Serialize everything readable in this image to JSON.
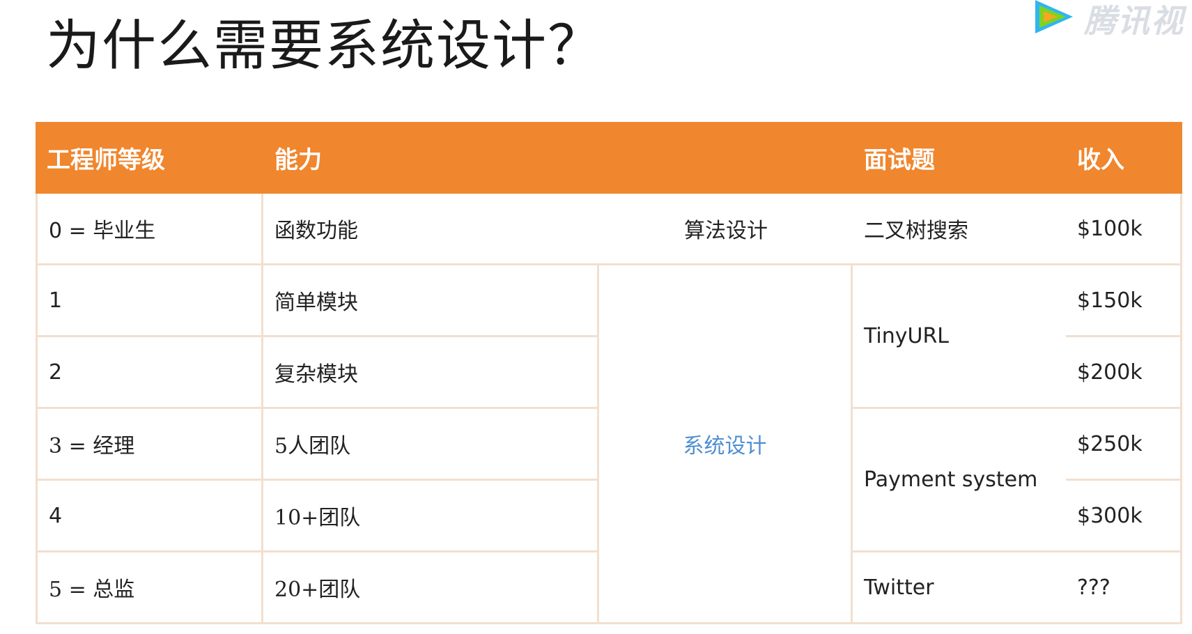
{
  "title": "为什么需要系统设计？",
  "watermark": {
    "text": "腾讯视",
    "icon": "tencent-video-play-icon"
  },
  "colors": {
    "header_bg": "#f0862e",
    "accent_blue": "#4f8fd0",
    "grid_line": "#f2dfcf"
  },
  "table": {
    "headers": [
      "工程师等级",
      "能力",
      "",
      "面试题",
      "收入"
    ],
    "rows": [
      {
        "level": "0 = 毕业生",
        "ability": "函数功能",
        "category": "算法设计",
        "question": "二叉树搜索",
        "income": "$100k"
      },
      {
        "level": "1",
        "ability": "简单模块",
        "income": "$150k"
      },
      {
        "level": "2",
        "ability": "复杂模块",
        "income": "$200k"
      },
      {
        "level": "3 = 经理",
        "ability": "5人团队",
        "income": "$250k"
      },
      {
        "level": "4",
        "ability": "10+团队",
        "income": "$300k"
      },
      {
        "level": "5 = 总监",
        "ability": "20+团队",
        "question": "Twitter",
        "income": "???"
      }
    ],
    "merged": {
      "category_system": "系统设计",
      "question_tinyurl": "TinyURL",
      "question_payment": "Payment system"
    }
  }
}
